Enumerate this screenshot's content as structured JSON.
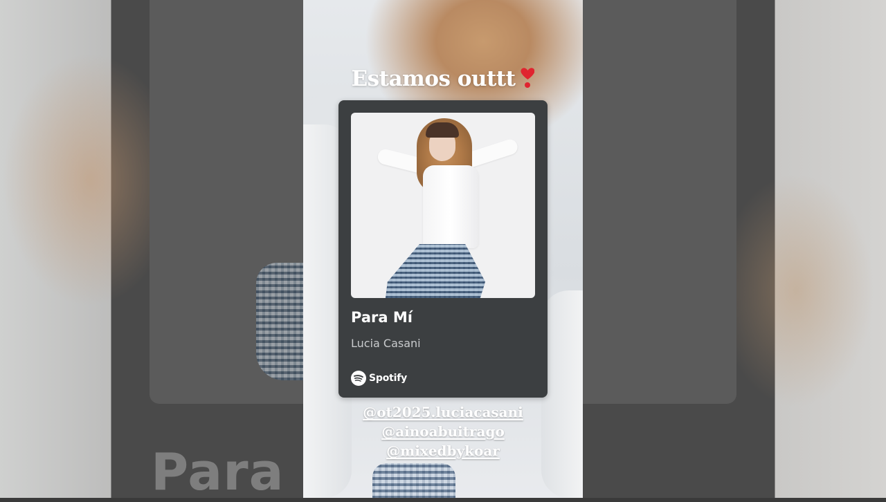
{
  "story": {
    "caption": "Estamos outtt",
    "caption_emoji": "heavy-red-exclamation-heart",
    "accent_color": "#e0242f"
  },
  "music_card": {
    "song_title": "Para Mí",
    "artist": "Lucia Casani",
    "platform": "Spotify",
    "card_color": "#3c3f41"
  },
  "mentions": [
    "@ot2025.luciacasani",
    "@ainoabuitrago",
    "@mixedbykoar"
  ],
  "background": {
    "large_text": "Para Mí"
  }
}
